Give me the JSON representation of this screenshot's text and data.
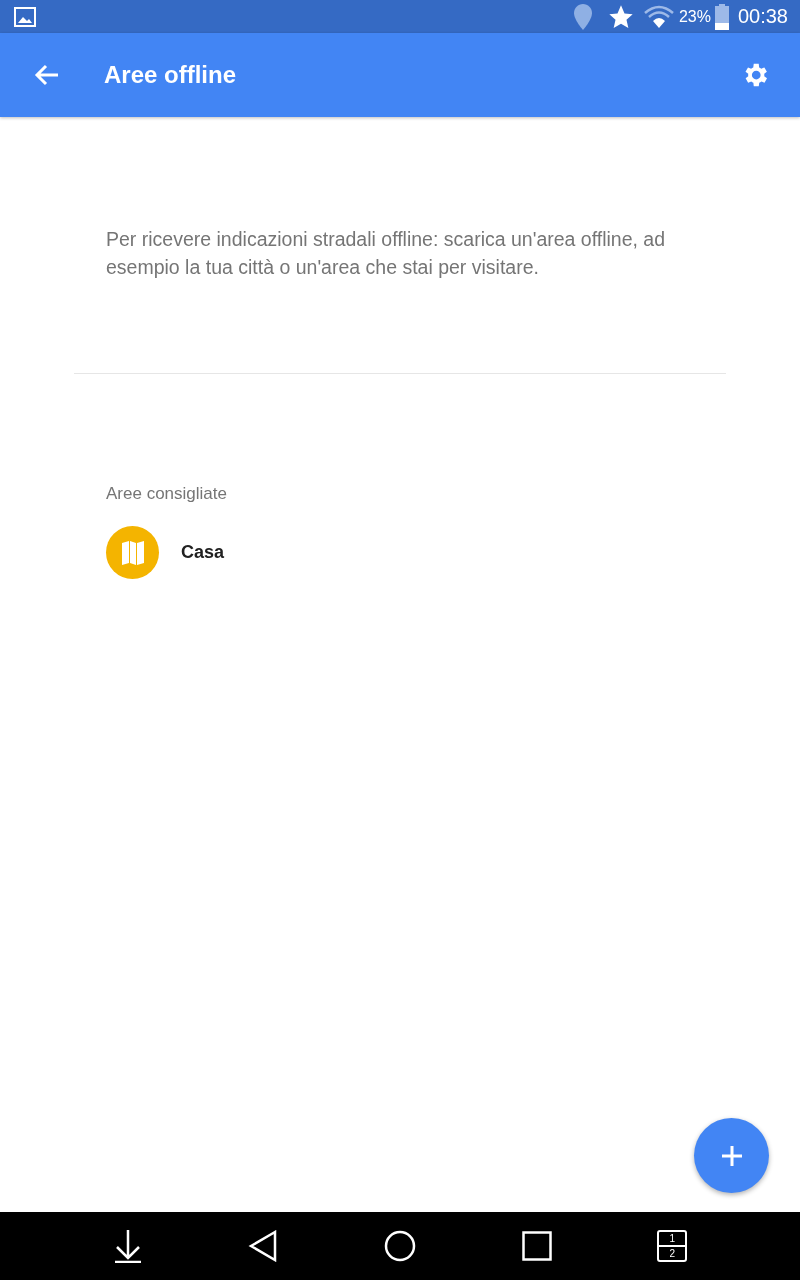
{
  "status_bar": {
    "battery": "23%",
    "time": "00:38"
  },
  "toolbar": {
    "title": "Aree offline"
  },
  "intro": "Per ricevere indicazioni stradali offline: scarica un'area offline, ad esempio la tua città o un'area che stai per visitare.",
  "suggested": {
    "heading": "Aree consigliate",
    "items": [
      {
        "name": "Casa"
      }
    ]
  },
  "nav_bar": {
    "split_labels": [
      "1",
      "2"
    ]
  }
}
